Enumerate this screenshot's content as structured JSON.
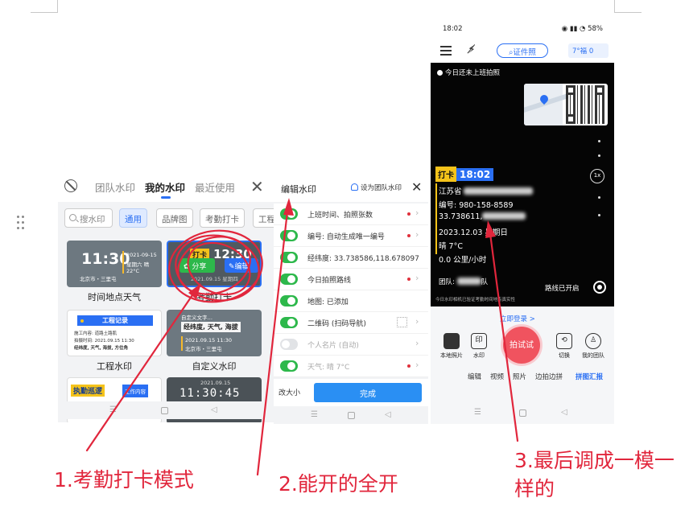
{
  "panel1": {
    "tabs": [
      "团队水印",
      "我的水印",
      "最近使用"
    ],
    "search_placeholder": "搜水印",
    "filters": [
      "通用",
      "品牌图",
      "考勤打卡",
      "工程"
    ],
    "cards": [
      {
        "label": "时间地点天气",
        "time": "11:30",
        "date": "2021-09-15",
        "weather": "星期六 晴 22°C",
        "place": "北京市・三里屯"
      },
      {
        "label": "考勤打卡",
        "tag": "打卡",
        "time": "12:30",
        "date": "2021.09.15 星期四",
        "share": "分享",
        "edit": "编辑"
      },
      {
        "label": "工程水印",
        "header": "工程记录",
        "rows": [
          "施工内容: 道路土路肌",
          "拍摄时间: 2021.09.15 11:30",
          "经纬度, 天气, 海拔, 方位角"
        ]
      },
      {
        "label": "自定义水印",
        "caption": "自定义文字…",
        "highlight": "经纬度, 天气, 海拔",
        "line1": "2021.09.15  11:30",
        "line2": "北京市・三里屯"
      },
      {
        "label": "",
        "a": "执勤巡逻",
        "b": "工作内容"
      },
      {
        "label": "",
        "date": "2021.09.15",
        "time": "11:30:45"
      }
    ]
  },
  "panel2": {
    "title": "编辑水印",
    "team_label": "设为团队水印",
    "rows": [
      {
        "label": "上班时间、拍照张数",
        "on": true,
        "dot": true
      },
      {
        "label": "编号: 自动生成唯一编号",
        "on": true,
        "dot": true
      },
      {
        "label": "经纬度: 33.738586,118.678097",
        "on": true,
        "dot": false
      },
      {
        "label": "今日拍照路线",
        "on": true,
        "dot": true
      },
      {
        "label": "地图: 已添加",
        "on": true,
        "dot": false
      },
      {
        "label": "二维码 (扫码导航)",
        "on": true,
        "dot": false
      },
      {
        "label": "个人名片 (自动)",
        "on": false,
        "dot": false
      },
      {
        "label": "天气: 晴 7°C",
        "on": true,
        "dot": true
      }
    ],
    "resize_label": "改大小",
    "done_label": "完成"
  },
  "panel3": {
    "status_time": "18:02",
    "status_right": "58%",
    "id_photo": "证件照",
    "zoom": "7°福  0",
    "notice": "今日还未上班拍照",
    "zoom_btn": "1x",
    "punch_key": "打卡",
    "punch_time": "18:02",
    "lines": [
      "江苏省",
      "编号: 980-158-8589",
      "33.738611,",
      "2023.12.03 星期日",
      "晴 7°C",
      "0.0 公里/小时"
    ],
    "team": "团队:",
    "team_suffix": "队",
    "route_open": "路线已开启",
    "verified": "今日水印相机已验证考勤时间地点真实性",
    "login": "立即登录 >",
    "actions": [
      "本地照片",
      "水印",
      "切换",
      "我的团队"
    ],
    "shoot": "拍试试",
    "modes": [
      "编辑",
      "视频",
      "照片",
      "边拍边拼",
      "拼图汇报"
    ]
  },
  "annotations": [
    "1.考勤打卡模式",
    "2.能开的全开",
    "3.最后调成一模一",
    "样的"
  ],
  "colors": {
    "annotation": "#e1263c",
    "primary": "#2a6ff3",
    "toggle_on": "#2db84b",
    "punch_tag": "#f5c31a"
  }
}
